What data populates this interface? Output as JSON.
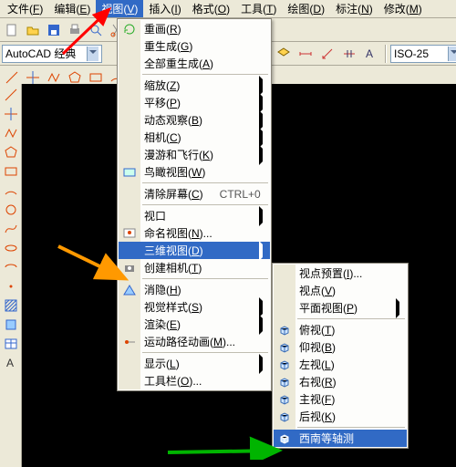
{
  "menubar": {
    "items": [
      {
        "label": "文件",
        "hot": "F"
      },
      {
        "label": "编辑",
        "hot": "E"
      },
      {
        "label": "视图",
        "hot": "V",
        "selected": true
      },
      {
        "label": "插入",
        "hot": "I"
      },
      {
        "label": "格式",
        "hot": "O"
      },
      {
        "label": "工具",
        "hot": "T"
      },
      {
        "label": "绘图",
        "hot": "D"
      },
      {
        "label": "标注",
        "hot": "N"
      },
      {
        "label": "修改",
        "hot": "M"
      }
    ]
  },
  "workspace_combo": "AutoCAD 经典",
  "dimstyle_combo": "ISO-25",
  "view_menu": {
    "items": [
      {
        "label": "重画",
        "hot": "R",
        "icon": "refresh"
      },
      {
        "label": "重生成",
        "hot": "G"
      },
      {
        "label": "全部重生成",
        "hot": "A"
      },
      {
        "sep": true
      },
      {
        "label": "缩放",
        "hot": "Z",
        "sub": true
      },
      {
        "label": "平移",
        "hot": "P",
        "sub": true
      },
      {
        "label": "动态观察",
        "hot": "B",
        "sub": true
      },
      {
        "label": "相机",
        "hot": "C",
        "sub": true
      },
      {
        "label": "漫游和飞行",
        "hot": "K",
        "sub": true
      },
      {
        "label": "鸟瞰视图",
        "hot": "W",
        "icon": "aerial"
      },
      {
        "sep": true
      },
      {
        "label": "清除屏幕",
        "hot": "C",
        "shortcut": "CTRL+0"
      },
      {
        "sep": true
      },
      {
        "label": "视口",
        "sub": true
      },
      {
        "label": "命名视图",
        "hot": "N",
        "trail": "...",
        "icon": "named-view"
      },
      {
        "label": "三维视图",
        "hot": "D",
        "sub": true,
        "selected": true
      },
      {
        "label": "创建相机",
        "hot": "T",
        "icon": "camera"
      },
      {
        "sep": true
      },
      {
        "label": "消隐",
        "hot": "H",
        "icon": "hide"
      },
      {
        "label": "视觉样式",
        "hot": "S",
        "sub": true
      },
      {
        "label": "渲染",
        "hot": "E",
        "sub": true
      },
      {
        "label": "运动路径动画",
        "hot": "M",
        "trail": "...",
        "icon": "motion"
      },
      {
        "sep": true
      },
      {
        "label": "显示",
        "hot": "L",
        "sub": true
      },
      {
        "label": "工具栏",
        "hot": "O",
        "trail": "..."
      }
    ]
  },
  "sub_menu": {
    "items": [
      {
        "label": "视点预置",
        "hot": "I",
        "trail": "..."
      },
      {
        "label": "视点",
        "hot": "V"
      },
      {
        "label": "平面视图",
        "hot": "P",
        "sub": true
      },
      {
        "sep": true
      },
      {
        "label": "俯视",
        "hot": "T",
        "icon": "cube"
      },
      {
        "label": "仰视",
        "hot": "B",
        "icon": "cube"
      },
      {
        "label": "左视",
        "hot": "L",
        "icon": "cube"
      },
      {
        "label": "右视",
        "hot": "R",
        "icon": "cube"
      },
      {
        "label": "主视",
        "hot": "F",
        "icon": "cube"
      },
      {
        "label": "后视",
        "hot": "K",
        "icon": "cube"
      },
      {
        "sep": true
      },
      {
        "label": "西南等轴测",
        "icon": "iso",
        "selected": true
      }
    ]
  },
  "left_tool_icons": [
    "line",
    "xline",
    "pline",
    "polygon",
    "rect",
    "arc",
    "circle",
    "spline",
    "ellipse",
    "earc",
    "point",
    "hatch",
    "region",
    "table",
    "text"
  ],
  "tb1_icons": [
    "new",
    "open",
    "save",
    "print",
    "preview",
    "cut",
    "copy",
    "paste"
  ],
  "tb3_icons": [
    "line",
    "xline",
    "pline",
    "poly",
    "rect",
    "arc",
    "circle",
    "revcloud",
    "spline",
    "ellipse"
  ],
  "colors": {
    "sel": "#316ac5",
    "menu_bg": "#fdfdfb",
    "frame": "#ece9d8"
  }
}
